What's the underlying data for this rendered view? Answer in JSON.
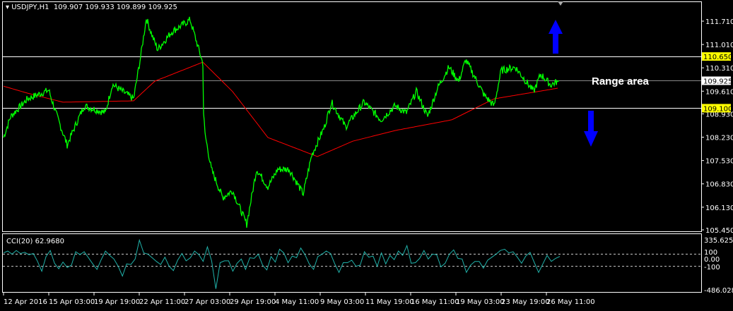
{
  "header": {
    "symbol": "USDJPY,H1",
    "ohlc": "109.907 109.933 109.899 109.925"
  },
  "annotation": {
    "text": "Range area"
  },
  "colors": {
    "price": "#00ff00",
    "ma": "#ff0000",
    "cci": "#20b2aa",
    "level_label_bg": "#ffff00",
    "arrow": "#0000ff"
  },
  "chart_data": [
    {
      "type": "line",
      "title": "USDJPY,H1",
      "ylim": [
        105.45,
        112.3
      ],
      "y_ticks": [
        "111.710",
        "111.010",
        "110.310",
        "109.610",
        "108.930",
        "108.230",
        "107.530",
        "106.830",
        "106.130",
        "105.450"
      ],
      "y_tick_values": [
        111.71,
        111.01,
        110.31,
        109.61,
        108.93,
        108.23,
        107.53,
        106.83,
        106.13,
        105.45
      ],
      "x_ticks": [
        "12 Apr 2016",
        "15 Apr 03:00",
        "19 Apr 19:00",
        "22 Apr 11:00",
        "27 Apr 03:00",
        "29 Apr 19:00",
        "4 May 11:00",
        "9 May 03:00",
        "11 May 19:00",
        "16 May 11:00",
        "19 May 03:00",
        "23 May 19:00",
        "26 May 11:00"
      ],
      "x_tick_bars": [
        0,
        32,
        64,
        96,
        128,
        160,
        192,
        224,
        256,
        288,
        320,
        352,
        384
      ],
      "levels": [
        {
          "label": "110.650",
          "value": 110.65
        },
        {
          "label": "109.100",
          "value": 109.1
        }
      ],
      "bid": {
        "label": "109.925",
        "value": 109.925
      },
      "series": [
        {
          "name": "Price",
          "bars": [
            0,
            5,
            17,
            32,
            37,
            45,
            50,
            57,
            72,
            77,
            92,
            97,
            101,
            105,
            109,
            119,
            132,
            141,
            141.5,
            142.5,
            147,
            155,
            162,
            172,
            179,
            187,
            194,
            202,
            212,
            218,
            227,
            232,
            242,
            255,
            267,
            277,
            285,
            292,
            300,
            307,
            315,
            322,
            327,
            340,
            347,
            352,
            362,
            375,
            380,
            387,
            393
          ],
          "values": [
            108.22,
            108.85,
            109.38,
            109.64,
            108.96,
            108.0,
            108.5,
            109.17,
            108.96,
            109.81,
            109.38,
            110.65,
            111.8,
            111.29,
            110.86,
            111.39,
            111.75,
            110.44,
            108.96,
            108.33,
            107.27,
            106.42,
            106.63,
            105.62,
            107.27,
            106.74,
            107.27,
            107.27,
            106.53,
            107.69,
            108.54,
            109.28,
            108.54,
            109.28,
            108.75,
            109.17,
            108.96,
            109.6,
            108.85,
            109.7,
            110.33,
            109.91,
            110.55,
            109.49,
            109.17,
            110.23,
            110.33,
            109.6,
            110.12,
            109.8,
            109.925
          ]
        },
        {
          "name": "MA",
          "bars": [
            0,
            17,
            42,
            92,
            107,
            141,
            162,
            187,
            222,
            247,
            277,
            317,
            347,
            392
          ],
          "values": [
            109.76,
            109.55,
            109.28,
            109.32,
            109.91,
            110.48,
            109.6,
            108.22,
            107.65,
            108.11,
            108.43,
            108.75,
            109.38,
            109.7
          ]
        }
      ]
    },
    {
      "type": "line",
      "title": "CCI(20) 62.9680",
      "ylim": [
        -486.0282,
        335.6251
      ],
      "y_ticks": [
        "335.6251",
        "100",
        "0.00",
        "-100",
        "-486.0282"
      ],
      "levels": [
        100,
        -100
      ],
      "series": [
        {
          "name": "CCI(20)",
          "values": [
            120,
            150,
            100,
            160,
            110,
            130,
            90,
            110,
            -20,
            -180,
            60,
            160,
            -50,
            -140,
            -30,
            -120,
            -80,
            140,
            90,
            140,
            40,
            -60,
            -150,
            10,
            150,
            80,
            20,
            -100,
            -260,
            -60,
            -70,
            20,
            330,
            120,
            100,
            40,
            -20,
            -70,
            50,
            -100,
            -170,
            0,
            110,
            -10,
            40,
            150,
            90,
            -20,
            220,
            -10,
            -470,
            -40,
            -10,
            -10,
            -180,
            -50,
            20,
            -150,
            40,
            30,
            100,
            -80,
            -160,
            60,
            -30,
            180,
            120,
            -40,
            70,
            40,
            200,
            90,
            -60,
            -150,
            60,
            100,
            150,
            110,
            -60,
            -200,
            -40,
            -40,
            0,
            -100,
            -80,
            140,
            50,
            70,
            -100,
            120,
            -60,
            80,
            10,
            150,
            80,
            240,
            -50,
            -40,
            30,
            160,
            20,
            100,
            90,
            -110,
            -50,
            100,
            170,
            30,
            20,
            -200,
            -80,
            -20,
            -20,
            -130,
            0,
            50,
            100,
            160,
            180,
            120,
            140,
            50,
            -50,
            70,
            130,
            -40,
            -200,
            -60,
            80,
            -20,
            30,
            63
          ]
        }
      ]
    }
  ]
}
